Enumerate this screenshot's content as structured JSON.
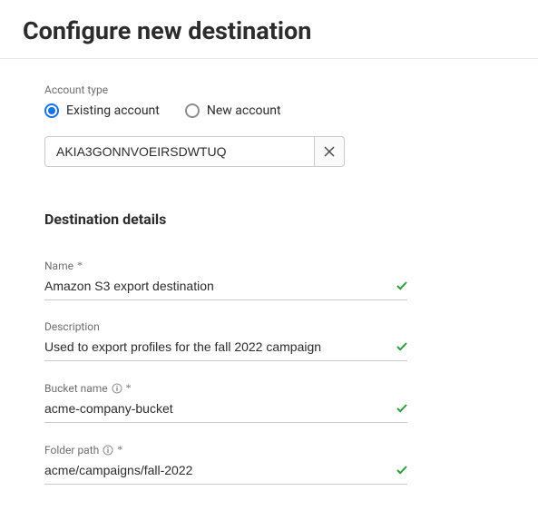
{
  "page": {
    "title": "Configure new destination"
  },
  "account": {
    "label": "Account type",
    "existing_label": "Existing account",
    "new_label": "New account",
    "selected": "existing",
    "value": "AKIA3GONNVOEIRSDWTUQ"
  },
  "details": {
    "section_title": "Destination details",
    "name": {
      "label": "Name",
      "value": "Amazon S3 export destination"
    },
    "description": {
      "label": "Description",
      "value": "Used to export profiles for the fall 2022 campaign"
    },
    "bucket": {
      "label": "Bucket name",
      "value": "acme-company-bucket"
    },
    "folder": {
      "label": "Folder path",
      "value": "acme/campaigns/fall-2022"
    }
  }
}
